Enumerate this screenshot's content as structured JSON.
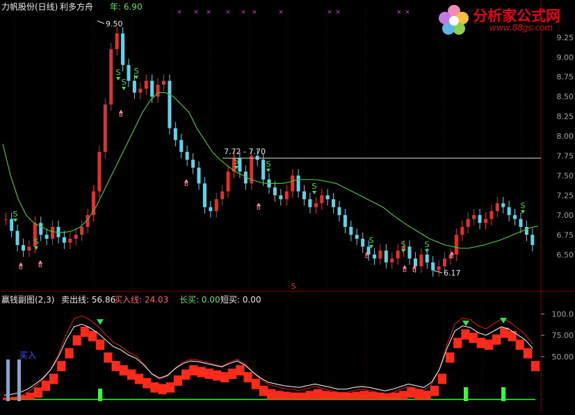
{
  "header": {
    "stock": "力帆股份(日线)",
    "title": "利多方舟",
    "year_label": "年: 6.90"
  },
  "logo": {
    "text": "分析家公式网",
    "url": "www.88gs.com"
  },
  "colors": {
    "up": "#e03030",
    "down": "#5fd3e8",
    "ma": "#4cbf3a",
    "sell_arrow": "#36e05a",
    "buy_arrow": "#ff8aa0",
    "magenta_marks": "#d040d0",
    "hline": "#c8c8c8",
    "white_curve": "#ffffff",
    "red_band": "#ff2a1a",
    "thin_red": "#e01818",
    "green_bar": "#33ff33",
    "blue_bar": "#7fa6d8",
    "axis": "#800000"
  },
  "annotations": {
    "high": "9.50",
    "low": "6.17",
    "range": "7.72 - 7.70",
    "s_marker": "S",
    "b_marker": "B",
    "mid_s": "S"
  },
  "sub_header": {
    "name": "赢钱副图(2,3)",
    "sell_line": "卖出线: 56.86",
    "buy_line": "买入线: 24.03",
    "long_buy": "长买: 0.00",
    "short_buy": "短买: 0.00"
  },
  "sub_labels": {
    "buy_in": "买入"
  },
  "chart_data": [
    {
      "type": "candlestick",
      "title": "利多方舟",
      "y_ticks": [
        6.5,
        6.75,
        7.0,
        7.25,
        7.5,
        7.75,
        8.0,
        8.25,
        8.5,
        8.75,
        9.0,
        9.25
      ],
      "ylim": [
        6.05,
        9.6
      ],
      "closes": [
        6.95,
        6.8,
        6.62,
        6.55,
        6.6,
        6.9,
        6.75,
        6.7,
        6.85,
        6.72,
        6.65,
        6.7,
        6.75,
        6.85,
        7.0,
        7.3,
        7.8,
        8.4,
        9.1,
        9.3,
        8.9,
        8.7,
        8.55,
        8.6,
        8.7,
        8.5,
        8.65,
        8.7,
        8.1,
        7.95,
        7.8,
        7.7,
        7.6,
        7.4,
        7.1,
        7.05,
        7.2,
        7.3,
        7.55,
        7.72,
        7.55,
        7.4,
        7.75,
        7.7,
        7.45,
        7.35,
        7.25,
        7.2,
        7.3,
        7.5,
        7.3,
        7.2,
        7.1,
        7.15,
        7.25,
        7.2,
        7.1,
        7.0,
        6.85,
        6.75,
        6.7,
        6.6,
        6.5,
        6.45,
        6.55,
        6.4,
        6.45,
        6.55,
        6.6,
        6.45,
        6.35,
        6.5,
        6.4,
        6.3,
        6.35,
        6.45,
        6.5,
        6.75,
        6.85,
        6.95,
        7.0,
        6.9,
        6.95,
        7.05,
        7.15,
        7.1,
        7.0,
        6.95,
        6.85,
        6.75,
        6.62
      ],
      "ma_series": [
        7.9,
        7.5,
        7.2,
        7.0,
        6.9,
        6.85,
        6.8,
        6.78,
        6.78,
        6.8,
        6.85,
        6.95,
        7.1,
        7.3,
        7.5,
        7.7,
        7.9,
        8.1,
        8.3,
        8.45,
        8.55,
        8.55,
        8.5,
        8.4,
        8.3,
        8.1,
        7.95,
        7.8,
        7.7,
        7.62,
        7.55,
        7.5,
        7.45,
        7.42,
        7.4,
        7.4,
        7.4,
        7.42,
        7.45,
        7.45,
        7.45,
        7.44,
        7.42,
        7.4,
        7.35,
        7.3,
        7.25,
        7.2,
        7.15,
        7.1,
        7.02,
        6.95,
        6.88,
        6.82,
        6.76,
        6.7,
        6.66,
        6.62,
        6.6,
        6.58,
        6.58,
        6.6,
        6.62,
        6.65,
        6.68,
        6.72,
        6.76,
        6.8,
        6.84,
        6.86
      ]
    },
    {
      "type": "line",
      "title": "赢钱副图(2,3)",
      "y_ticks": [
        50.0,
        75.0,
        100.0
      ],
      "ylim": [
        -2,
        110
      ],
      "series": [
        {
          "name": "卖出线",
          "values": [
            5,
            6,
            8,
            12,
            18,
            25,
            35,
            50,
            70,
            85,
            88,
            84,
            78,
            70,
            62,
            58,
            52,
            48,
            40,
            30,
            25,
            28,
            36,
            42,
            45,
            44,
            42,
            40,
            38,
            42,
            45,
            40,
            32,
            25,
            20,
            18,
            16,
            15,
            14,
            16,
            18,
            16,
            14,
            12,
            12,
            14,
            15,
            14,
            12,
            10,
            12,
            15,
            18,
            16,
            14,
            20,
            35,
            60,
            80,
            86,
            84,
            78,
            75,
            80,
            85,
            82,
            76,
            70,
            60
          ]
        },
        {
          "name": "买入线",
          "values": [
            2,
            3,
            5,
            8,
            14,
            22,
            30,
            45,
            60,
            75,
            85,
            80,
            70,
            55,
            45,
            40,
            35,
            30,
            25,
            20,
            18,
            20,
            28,
            35,
            40,
            38,
            36,
            34,
            32,
            36,
            40,
            32,
            24,
            16,
            12,
            10,
            9,
            8,
            8,
            10,
            12,
            10,
            9,
            8,
            8,
            9,
            10,
            9,
            8,
            7,
            8,
            10,
            14,
            12,
            10,
            16,
            30,
            55,
            72,
            82,
            78,
            72,
            70,
            76,
            84,
            80,
            70,
            60,
            45
          ]
        }
      ]
    }
  ]
}
